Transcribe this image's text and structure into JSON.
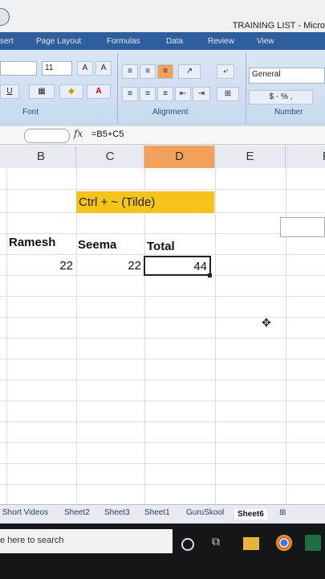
{
  "window": {
    "title": "TRAINING LIST - Micro"
  },
  "ribbon": {
    "tabs": [
      "sert",
      "Page Layout",
      "Formulas",
      "Data",
      "Review",
      "View"
    ],
    "font_size": "11",
    "number_format": "General",
    "groups": {
      "font": "Font",
      "alignment": "Alignment",
      "number": "Number"
    },
    "currency_btn": "$ - % ,"
  },
  "formula_bar": {
    "fx": "fx",
    "formula": "=B5+C5"
  },
  "columns": [
    "B",
    "C",
    "D",
    "E",
    "F"
  ],
  "cells": {
    "tilde_note": "Ctrl + ~ (Tilde)",
    "header_b": "Ramesh",
    "header_c": "Seema",
    "header_d": "Total",
    "val_b": "22",
    "val_c": "22",
    "val_d": "44"
  },
  "sheets": [
    "Short Videos",
    "Sheet2",
    "Sheet3",
    "Sheet1",
    "GuruSkool",
    "Sheet6"
  ],
  "active_sheet": "Sheet6",
  "taskbar": {
    "search_text": "e here to search"
  },
  "colors": {
    "accent": "#f4c41a",
    "active_col": "#f2a05a",
    "ribbon_tab": "#2f5e9e"
  }
}
